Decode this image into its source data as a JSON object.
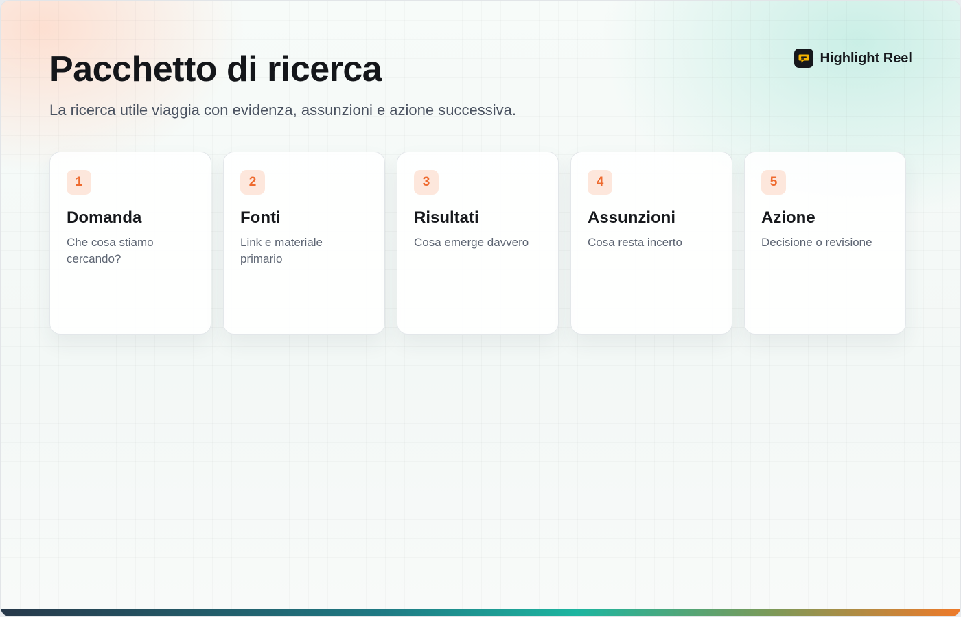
{
  "header": {
    "title": "Pacchetto di ricerca",
    "subtitle": "La ricerca utile viaggia con evidenza, assunzioni e azione successiva."
  },
  "brand": {
    "name": "Highlight Reel",
    "icon": "speech-bubble-icon"
  },
  "cards": [
    {
      "number": "1",
      "title": "Domanda",
      "description": "Che cosa stiamo cercando?"
    },
    {
      "number": "2",
      "title": "Fonti",
      "description": "Link e materiale primario"
    },
    {
      "number": "3",
      "title": "Risultati",
      "description": "Cosa emerge davvero"
    },
    {
      "number": "4",
      "title": "Assunzioni",
      "description": "Cosa resta incerto"
    },
    {
      "number": "5",
      "title": "Azione",
      "description": "Decisione o revisione"
    }
  ],
  "colors": {
    "accent": "#ee6a2e",
    "accent_soft": "#fde7dc",
    "text_dark": "#14161a",
    "text_muted": "#5d6573"
  }
}
